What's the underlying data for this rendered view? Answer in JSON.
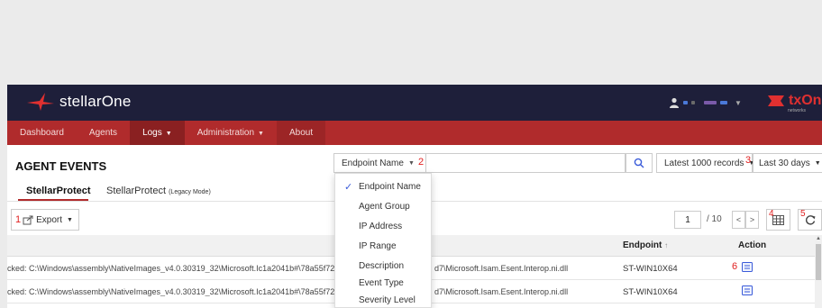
{
  "header": {
    "brand": "stellarOne",
    "partner_logo": "txOne",
    "partner_sub": "networks",
    "colors": {
      "header_bg": "#1e1f3a",
      "nav_bg": "#b02b2c",
      "logo_red": "#e03030"
    }
  },
  "nav": {
    "items": [
      {
        "label": "Dashboard"
      },
      {
        "label": "Agents"
      },
      {
        "label": "Logs",
        "dropdown": true,
        "active": true
      },
      {
        "label": "Administration",
        "dropdown": true
      },
      {
        "label": "About"
      }
    ]
  },
  "page": {
    "title": "AGENT EVENTS"
  },
  "search": {
    "field": "Endpoint Name",
    "value": "",
    "records": "Latest 1000 records",
    "period": "Last 30 days"
  },
  "tabs": [
    {
      "label": "StellarProtect",
      "active": true
    },
    {
      "label": "StellarProtect",
      "suffix": "(Legacy Mode)",
      "active": false
    }
  ],
  "toolbar": {
    "export_label": "Export",
    "page": "1",
    "total": "/ 10",
    "prev": "<",
    "next": ">"
  },
  "annotations": {
    "a1": "1",
    "a2": "2",
    "a3": "3",
    "a4": "4",
    "a5": "5",
    "a6": "6"
  },
  "table": {
    "columns": {
      "endpoint": "Endpoint",
      "action": "Action"
    },
    "rows": [
      {
        "path": "cked: C:\\Windows\\assembly\\NativeImages_v4.0.30319_32\\Microsoft.Ic1a2041b#\\78a55f72",
        "path_tail": "d7\\Microsoft.Isam.Esent.Interop.ni.dll",
        "endpoint": "ST-WIN10X64"
      },
      {
        "path": "cked: C:\\Windows\\assembly\\NativeImages_v4.0.30319_32\\Microsoft.Ic1a2041b#\\78a55f72",
        "path_tail": "d7\\Microsoft.Isam.Esent.Interop.ni.dll",
        "endpoint": "ST-WIN10X64"
      }
    ]
  },
  "dropdown": {
    "items": [
      "Endpoint Name",
      "Agent Group",
      "IP Address",
      "IP Range",
      "Description",
      "Event Type",
      "Severity Level"
    ],
    "selected_index": 0
  }
}
